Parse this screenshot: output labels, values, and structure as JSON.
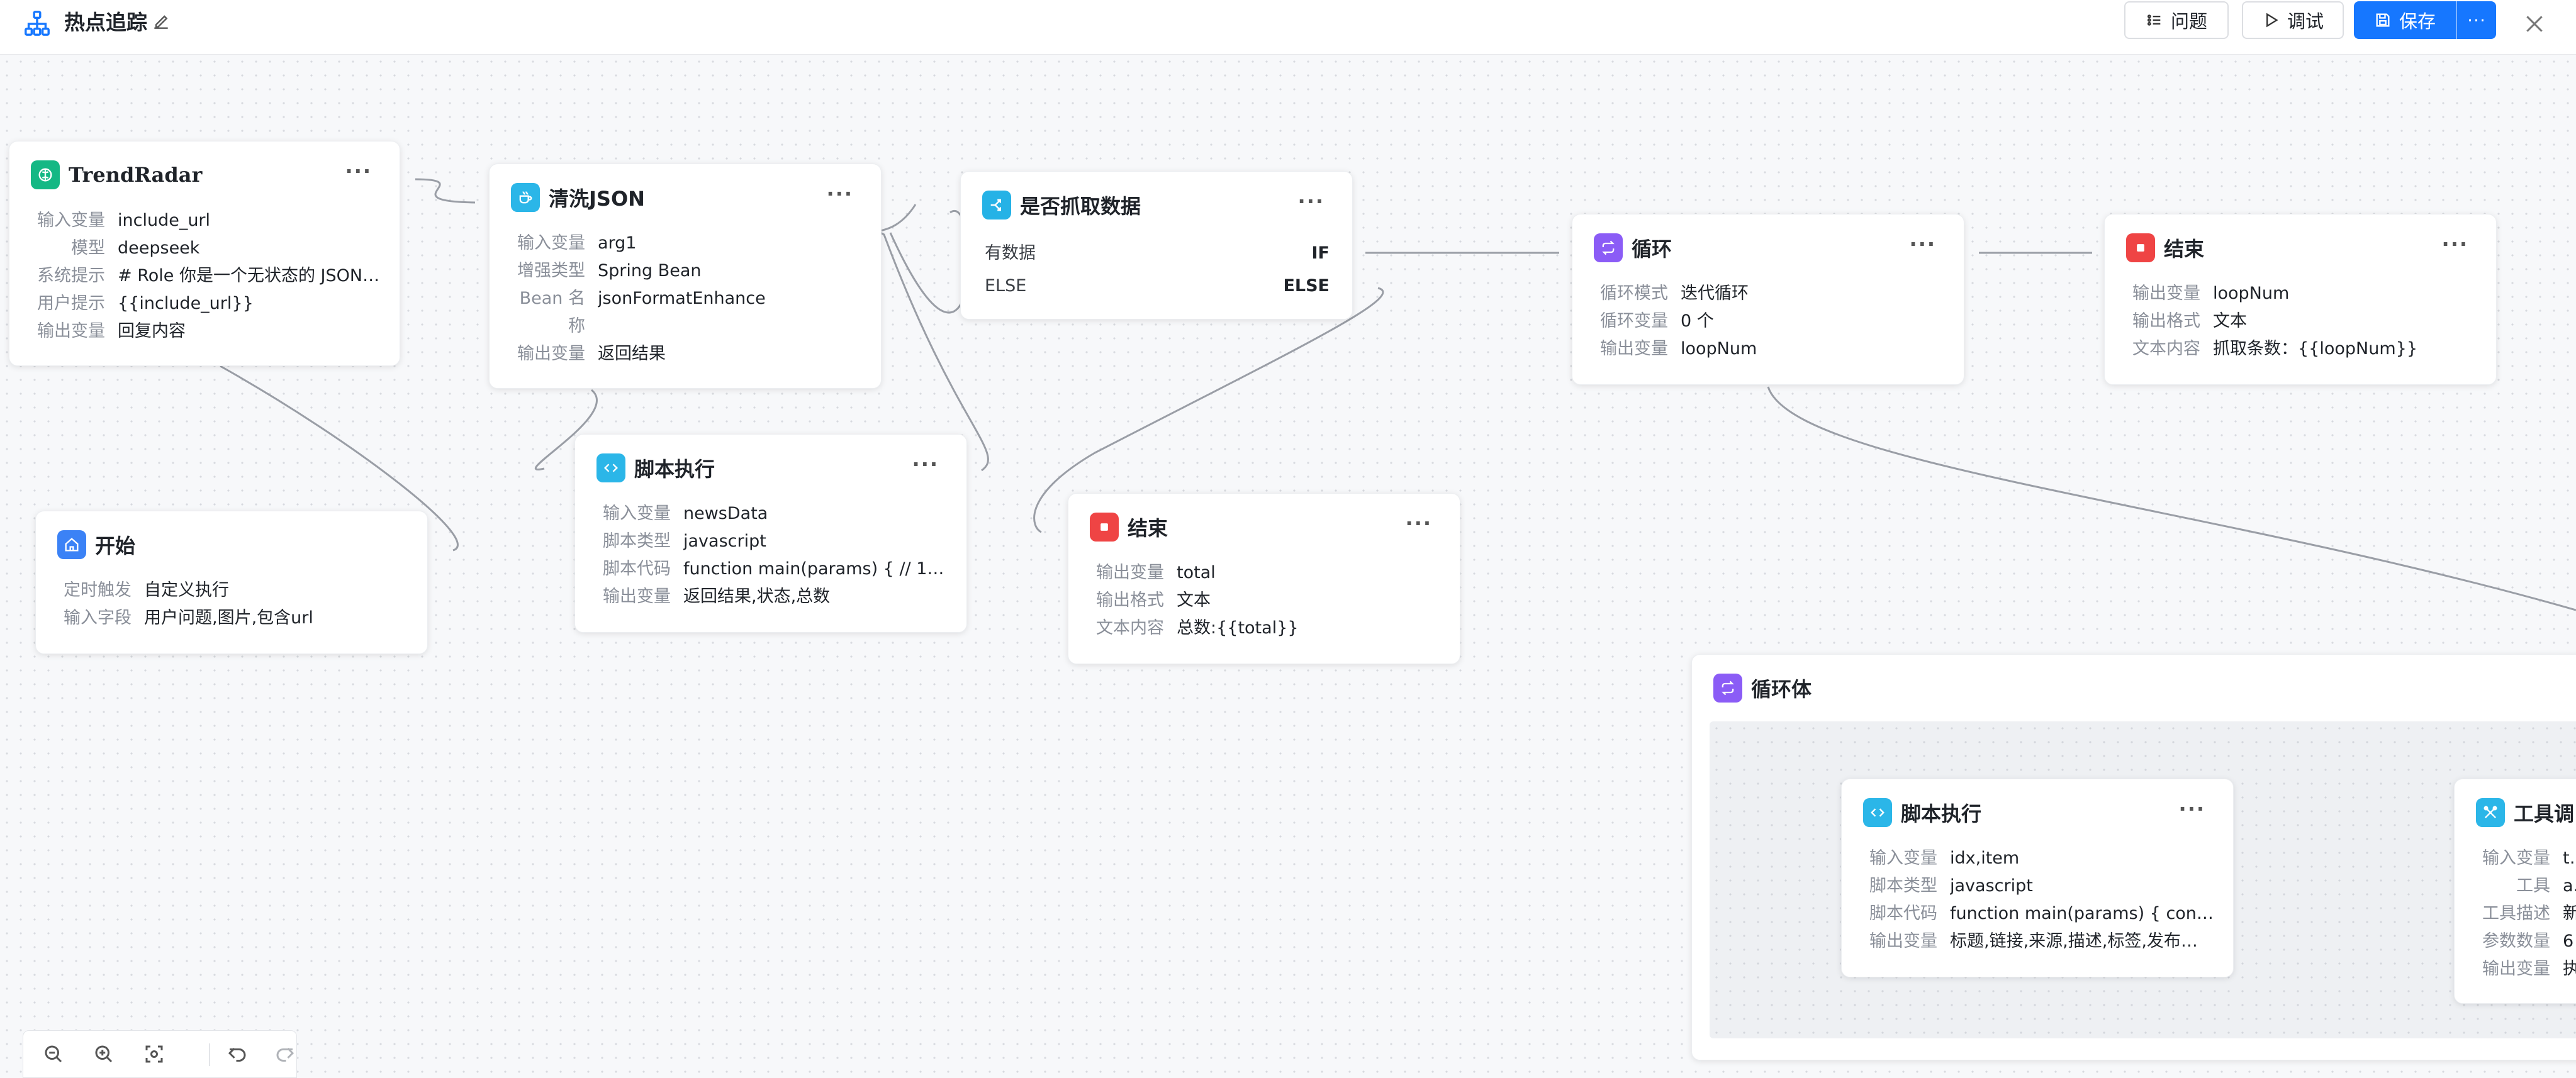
{
  "header": {
    "title": "热点追踪",
    "issue_label": "问题",
    "debug_label": "调试",
    "save_label": "保存",
    "more_label": "···"
  },
  "colors": {
    "primary": "#1677ff",
    "trendradar": "#14b884",
    "json": "#2bb6e8",
    "condition": "#25b2e6",
    "loop": "#8b5cf6",
    "end": "#ef4444",
    "start": "#3b82f6",
    "script": "#2bb6e8",
    "tool": "#2bb6e8"
  },
  "nodes": {
    "trendradar": {
      "title": "TrendRadar",
      "rows": [
        {
          "label": "输入变量",
          "value": "include_url"
        },
        {
          "label": "模型",
          "value": "deepseek"
        },
        {
          "label": "系统提示",
          "value": "# Role 你是一个无状态的 JSON…"
        },
        {
          "label": "用户提示",
          "value": "{{include_url}}"
        },
        {
          "label": "输出变量",
          "value": "回复内容"
        }
      ]
    },
    "clean_json": {
      "title": "清洗JSON",
      "rows": [
        {
          "label": "输入变量",
          "value": "arg1"
        },
        {
          "label": "增强类型",
          "value": "Spring Bean"
        },
        {
          "label": "Bean 名",
          "value": "jsonFormatEnhance"
        },
        {
          "label": "称",
          "value": ""
        },
        {
          "label": "输出变量",
          "value": "返回结果"
        }
      ]
    },
    "condition": {
      "title": "是否抓取数据",
      "rows": [
        {
          "label": "有数据",
          "value": "IF"
        },
        {
          "label": "ELSE",
          "value": "ELSE"
        }
      ]
    },
    "loop": {
      "title": "循环",
      "rows": [
        {
          "label": "循环模式",
          "value": "迭代循环"
        },
        {
          "label": "循环变量",
          "value": "0 个"
        },
        {
          "label": "输出变量",
          "value": "loopNum"
        }
      ]
    },
    "end_top": {
      "title": "结束",
      "rows": [
        {
          "label": "输出变量",
          "value": "loopNum"
        },
        {
          "label": "输出格式",
          "value": "文本"
        },
        {
          "label": "文本内容",
          "value": "抓取条数：{{loopNum}}"
        }
      ]
    },
    "script_mid": {
      "title": "脚本执行",
      "rows": [
        {
          "label": "输入变量",
          "value": "newsData"
        },
        {
          "label": "脚本类型",
          "value": "javascript"
        },
        {
          "label": "脚本代码",
          "value": "function main(params) { // 1. 这…"
        },
        {
          "label": "输出变量",
          "value": "返回结果,状态,总数"
        }
      ]
    },
    "start": {
      "title": "开始",
      "rows": [
        {
          "label": "定时触发",
          "value": "自定义执行"
        },
        {
          "label": "输入字段",
          "value": "用户问题,图片,包含url"
        }
      ]
    },
    "end_mid": {
      "title": "结束",
      "rows": [
        {
          "label": "输出变量",
          "value": "total"
        },
        {
          "label": "输出格式",
          "value": "文本"
        },
        {
          "label": "文本内容",
          "value": "总数:{{total}}"
        }
      ]
    },
    "loop_body": {
      "title": "循环体"
    },
    "script_inner": {
      "title": "脚本执行",
      "rows": [
        {
          "label": "输入变量",
          "value": "idx,item"
        },
        {
          "label": "脚本类型",
          "value": "javascript"
        },
        {
          "label": "脚本代码",
          "value": "function main(params) { const …"
        },
        {
          "label": "输出变量",
          "value": "标题,链接,来源,描述,标签,发布…"
        }
      ]
    },
    "tool_call": {
      "title": "工具调",
      "rows": [
        {
          "label": "输入变量",
          "value": "tit"
        },
        {
          "label": "工具",
          "value": "ac"
        },
        {
          "label": "工具描述",
          "value": "新"
        },
        {
          "label": "参数数量",
          "value": "6"
        },
        {
          "label": "输出变量",
          "value": "执"
        }
      ]
    }
  },
  "icons": {
    "app": "workflow-icon",
    "edit": "edit-icon",
    "close": "close-icon",
    "zoom_out": "zoom-out-icon",
    "zoom_in": "zoom-in-icon",
    "fit": "fit-view-icon",
    "undo": "undo-icon",
    "redo": "redo-icon"
  }
}
